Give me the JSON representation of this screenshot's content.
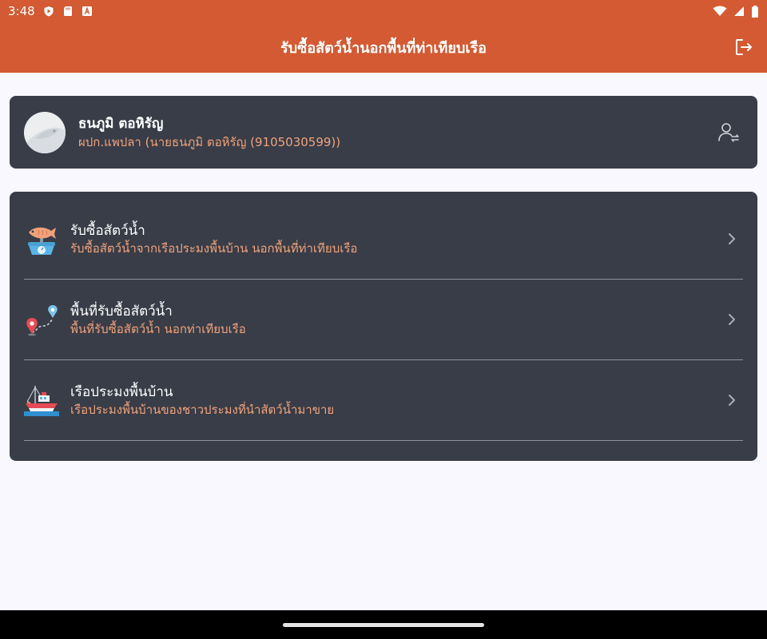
{
  "status_bar": {
    "time": "3:48",
    "icons_left": [
      "play-shield-icon",
      "sd-card-icon",
      "font-a-icon"
    ],
    "icons_right": [
      "wifi-icon",
      "signal-icon",
      "battery-icon"
    ]
  },
  "app_bar": {
    "title": "รับซื้อสัตว์น้ำนอกพื้นที่ท่าเทียบเรือ",
    "action_icon": "logout-icon"
  },
  "profile": {
    "name": "ธนภูมิ ตอหิรัญ",
    "subtitle": "ผปก.แพปลา (นายธนภูมิ ตอหิรัญ (9105030599))",
    "avatar_icon": "fish-avatar-icon",
    "action_icon": "switch-user-icon"
  },
  "menu": {
    "items": [
      {
        "title": "รับซื้อสัตว์น้ำ",
        "subtitle": "รับซื้อสัตว์น้ำจากเรือประมงพื้นบ้าน นอกพื้นที่ท่าเทียบเรือ",
        "icon": "fish-scale-icon"
      },
      {
        "title": "พื้นที่รับซื้อสัตว์น้ำ",
        "subtitle": "พื้นที่รับซื้อสัตว์น้ำ นอกท่าเทียบเรือ",
        "icon": "map-route-icon"
      },
      {
        "title": "เรือประมงพื้นบ้าน",
        "subtitle": "เรือประมงพื้นบ้านของชาวประมงที่นำสัตว์น้ำมาขาย",
        "icon": "fishing-boat-icon"
      }
    ]
  },
  "colors": {
    "primary": "#d35a32",
    "card": "#383d48",
    "accent_text": "#f2a27a",
    "background": "#f9f8fe"
  }
}
